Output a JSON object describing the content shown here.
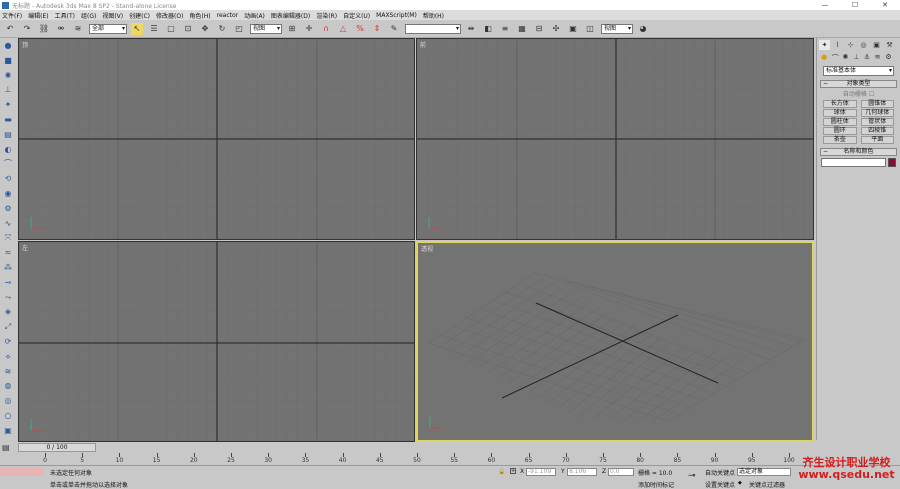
{
  "window": {
    "title": "无标题 - Autodesk 3ds Max 8 SP2 - Stand-alone License",
    "minimize": "—",
    "maximize": "☐",
    "close": "✕"
  },
  "menu": [
    "文件(F)",
    "编辑(E)",
    "工具(T)",
    "组(G)",
    "视图(V)",
    "创建(C)",
    "修改器(O)",
    "角色(H)",
    "reactor",
    "动画(A)",
    "图表编辑器(D)",
    "渲染(R)",
    "自定义(U)",
    "MAXScript(M)",
    "帮助(H)"
  ],
  "toolbar": {
    "selection_filter": "全部",
    "ref_coord": "视图",
    "named_selection": "",
    "render_type": "视图"
  },
  "viewports": {
    "top": "顶",
    "front": "前",
    "left": "左",
    "perspective": "透视"
  },
  "command_panel": {
    "category": "标准基本体",
    "object_type_header": "对象类型",
    "autogrid": "自动栅格",
    "buttons": [
      "长方体",
      "圆锥体",
      "球体",
      "几何球体",
      "圆柱体",
      "管状体",
      "圆环",
      "四棱锥",
      "茶壶",
      "平面"
    ],
    "name_color_header": "名称和颜色",
    "object_color": "#8b0a3a"
  },
  "timeline": {
    "slider": "0 / 100",
    "ticks": [
      "0",
      "5",
      "10",
      "15",
      "20",
      "25",
      "30",
      "35",
      "40",
      "45",
      "50",
      "55",
      "60",
      "65",
      "70",
      "75",
      "80",
      "85",
      "90",
      "95",
      "100"
    ]
  },
  "status": {
    "selection": "未选定任何对象",
    "prompt": "单击或单击并拖动以选择对象",
    "x_label": "X",
    "x_value": "-91.109",
    "y_label": "Y",
    "y_value": "8.106",
    "z_label": "Z",
    "z_value": "0.0",
    "grid": "栅格 = 10.0",
    "add_time_tag": "添加时间标记",
    "auto_key": "自动关键点",
    "selected_object": "选定对象",
    "set_key": "设置关键点",
    "key_filters": "关键点过滤器"
  },
  "watermark": {
    "name": "齐生设计职业学校",
    "url": "www.qsedu.net"
  }
}
